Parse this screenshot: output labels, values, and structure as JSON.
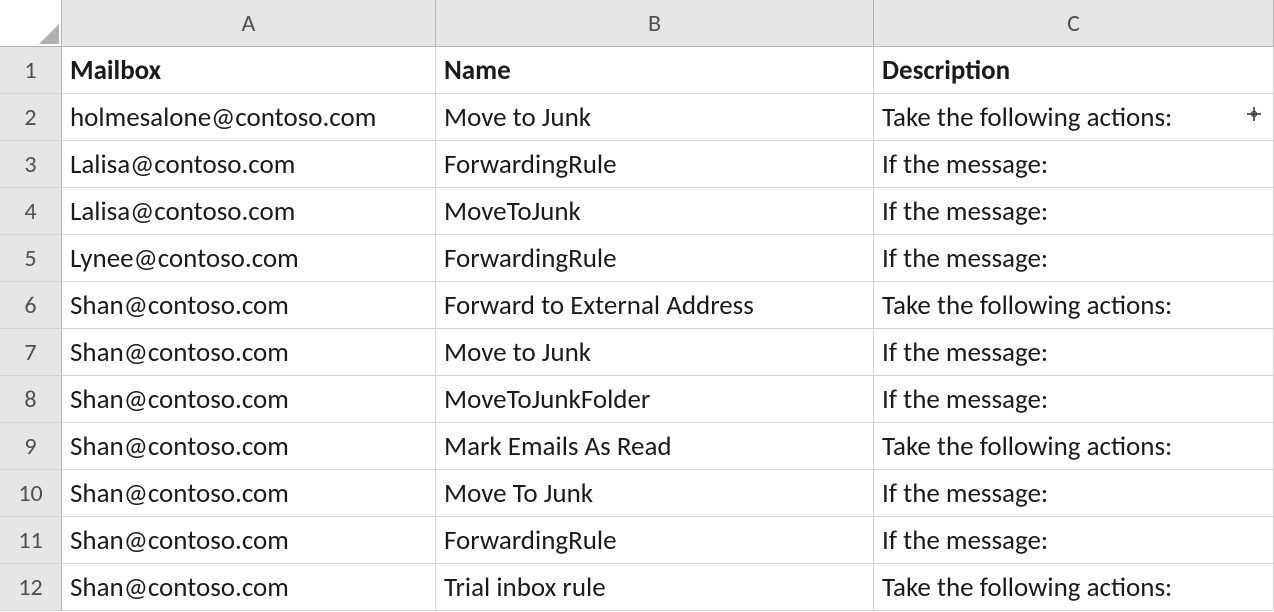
{
  "columns": [
    "A",
    "B",
    "C"
  ],
  "rowNumbers": [
    "1",
    "2",
    "3",
    "4",
    "5",
    "6",
    "7",
    "8",
    "9",
    "10",
    "11",
    "12"
  ],
  "headerRow": {
    "mailbox": "Mailbox",
    "name": "Name",
    "description": "Description"
  },
  "rows": [
    {
      "mailbox": "holmesalone@contoso.com",
      "name": "Move to Junk",
      "description": "Take the following actions:"
    },
    {
      "mailbox": "Lalisa@contoso.com",
      "name": "ForwardingRule",
      "description": "If the message:"
    },
    {
      "mailbox": "Lalisa@contoso.com",
      "name": "MoveToJunk",
      "description": "If the message:"
    },
    {
      "mailbox": "Lynee@contoso.com",
      "name": "ForwardingRule",
      "description": "If the message:"
    },
    {
      "mailbox": "Shan@contoso.com",
      "name": "Forward to External Address",
      "description": "Take the following actions:"
    },
    {
      "mailbox": "Shan@contoso.com",
      "name": "Move to Junk",
      "description": "If the message:"
    },
    {
      "mailbox": "Shan@contoso.com",
      "name": "MoveToJunkFolder",
      "description": "If the message:"
    },
    {
      "mailbox": "Shan@contoso.com",
      "name": "Mark Emails As Read",
      "description": "Take the following actions:"
    },
    {
      "mailbox": "Shan@contoso.com",
      "name": "Move To Junk",
      "description": "If the message:"
    },
    {
      "mailbox": "Shan@contoso.com",
      "name": "ForwardingRule",
      "description": "If the message:"
    },
    {
      "mailbox": "Shan@contoso.com",
      "name": "Trial inbox rule",
      "description": "Take the following actions:"
    }
  ]
}
